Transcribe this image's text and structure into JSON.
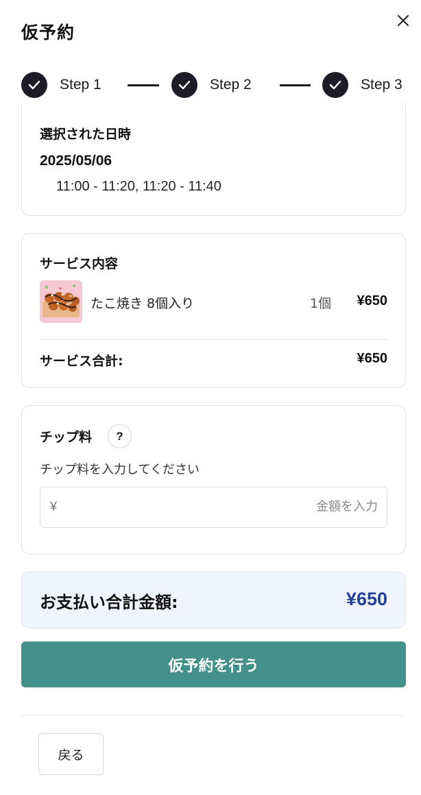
{
  "modal": {
    "title": "仮予約"
  },
  "steps": [
    {
      "label": "Step 1"
    },
    {
      "label": "Step 2"
    },
    {
      "label": "Step 3"
    }
  ],
  "datetime": {
    "section_title": "選択された日時",
    "date": "2025/05/06",
    "times": "11:00 - 11:20, 11:20 - 11:40"
  },
  "service": {
    "section_title": "サービス内容",
    "items": [
      {
        "name": "たこ焼き 8個入り",
        "qty": "1個",
        "price": "¥650"
      }
    ],
    "total_label": "サービス合計:",
    "total_value": "¥650"
  },
  "tip": {
    "section_title": "チップ料",
    "help_label": "?",
    "hint": "チップ料を入力してください",
    "currency_prefix": "¥",
    "input_value": "",
    "input_placeholder": "金額を入力"
  },
  "payment": {
    "total_label": "お支払い合計金額:",
    "total_value": "¥650"
  },
  "actions": {
    "submit_label": "仮予約を行う",
    "back_label": "戻る"
  },
  "colors": {
    "primary": "#43918a",
    "total_accent": "#27409a",
    "total_bg": "#eff4ff",
    "step_done": "#1c1c28"
  },
  "icons": {
    "close": "close-icon",
    "step_done": "check-icon",
    "help": "question-icon"
  }
}
